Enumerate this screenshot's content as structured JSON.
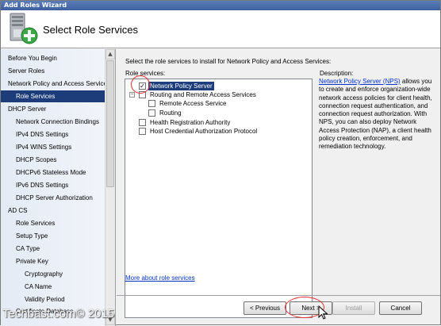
{
  "window": {
    "title": "Add Roles Wizard"
  },
  "header": {
    "title": "Select Role Services",
    "icon": "server-roles-add-icon"
  },
  "nav": {
    "items": [
      {
        "label": "Before You Begin"
      },
      {
        "label": "Server Roles"
      },
      {
        "label": "Network Policy and Access Services"
      },
      {
        "label": "Role Services"
      },
      {
        "label": "DHCP Server"
      },
      {
        "label": "Network Connection Bindings"
      },
      {
        "label": "IPv4 DNS Settings"
      },
      {
        "label": "IPv4 WINS Settings"
      },
      {
        "label": "DHCP Scopes"
      },
      {
        "label": "DHCPv6 Stateless Mode"
      },
      {
        "label": "IPv6 DNS Settings"
      },
      {
        "label": "DHCP Server Authorization"
      },
      {
        "label": "AD CS"
      },
      {
        "label": "Role Services"
      },
      {
        "label": "Setup Type"
      },
      {
        "label": "CA Type"
      },
      {
        "label": "Private Key"
      },
      {
        "label": "Cryptography"
      },
      {
        "label": "CA Name"
      },
      {
        "label": "Validity Period"
      },
      {
        "label": "Certificate Database"
      }
    ],
    "selected": "Role Services"
  },
  "main": {
    "instruction": "Select the role services to install for Network Policy and Access Services:",
    "role_services_label": "Role services:",
    "tree": [
      {
        "label": "Network Policy Server",
        "checked": true
      },
      {
        "label": "Routing and Remote Access Services",
        "checked": false,
        "expander": "−"
      },
      {
        "label": "Remote Access Service",
        "checked": false
      },
      {
        "label": "Routing",
        "checked": false
      },
      {
        "label": "Health Registration Authority",
        "checked": false
      },
      {
        "label": "Host Credential Authorization Protocol",
        "checked": false
      }
    ],
    "check_glyph": "✓",
    "description_label": "Description:",
    "description_link": "Network Policy Server (NPS)",
    "description_text": " allows you to create and enforce organization-wide network access policies for client health, connection request authentication, and connection request authorization. With NPS, you can also deploy Network Access Protection (NAP), a client health policy creation, enforcement, and remediation technology.",
    "more_link": "More about role services"
  },
  "buttons": {
    "previous": "< Previous",
    "next": "Next >",
    "install": "Install",
    "cancel": "Cancel"
  },
  "scroll": {
    "up": "▲",
    "down": "▼"
  },
  "watermark": "Techbast.com© 2015",
  "colors": {
    "selection": "#1c3d7a",
    "link": "#0033cc",
    "annotation": "#e53030"
  }
}
